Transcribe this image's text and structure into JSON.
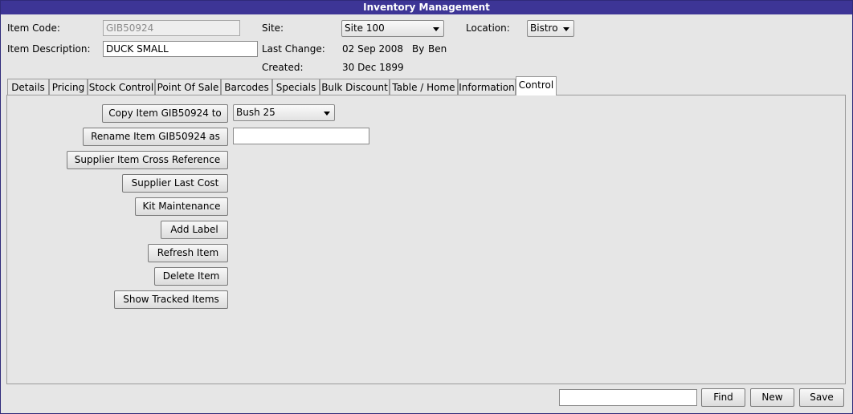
{
  "window": {
    "title": "Inventory Management"
  },
  "header": {
    "item_code_label": "Item Code:",
    "item_code_value": "GIB50924",
    "item_description_label": "Item Description:",
    "item_description_value": "DUCK SMALL",
    "site_label": "Site:",
    "site_value": "Site 100",
    "location_label": "Location:",
    "location_value": "Bistro",
    "last_change_label": "Last Change:",
    "last_change_date": "02 Sep 2008",
    "by_label": "By",
    "by_value": "Ben",
    "created_label": "Created:",
    "created_date": "30 Dec 1899"
  },
  "tabs": [
    {
      "label": "Details"
    },
    {
      "label": "Pricing"
    },
    {
      "label": "Stock Control"
    },
    {
      "label": "Point Of Sale"
    },
    {
      "label": "Barcodes"
    },
    {
      "label": "Specials"
    },
    {
      "label": "Bulk Discount"
    },
    {
      "label": "Table / Home"
    },
    {
      "label": "Information"
    },
    {
      "label": "Control",
      "active": true
    }
  ],
  "control": {
    "copy_button": "Copy Item GIB50924 to",
    "copy_target": "Bush 25",
    "rename_button": "Rename Item GIB50924 as",
    "rename_value": "",
    "supplier_xref_button": "Supplier Item Cross Reference",
    "supplier_last_cost_button": "Supplier Last Cost",
    "kit_maintenance_button": "Kit Maintenance",
    "add_label_button": "Add Label",
    "refresh_button": "Refresh Item",
    "delete_button": "Delete Item",
    "show_tracked_button": "Show Tracked Items"
  },
  "footer": {
    "find_value": "",
    "find_button": "Find",
    "new_button": "New",
    "save_button": "Save"
  },
  "colors": {
    "titlebar": "#3d3596",
    "window_border": "#2f2a7a",
    "background": "#e6e6e6"
  }
}
